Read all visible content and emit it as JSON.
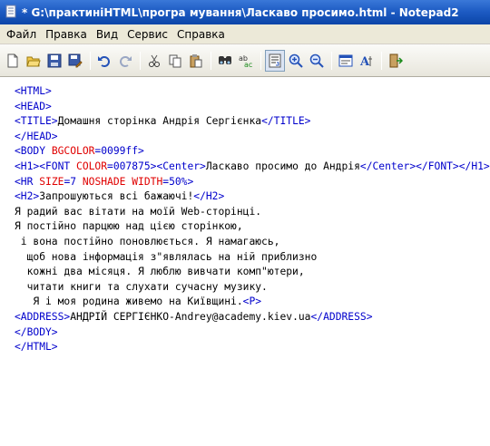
{
  "window": {
    "title": "* G:\\практиніHTML\\програ мування\\Ласкаво просимо.html - Notepad2"
  },
  "menu": [
    "Файл",
    "Правка",
    "Вид",
    "Сервис",
    "Справка"
  ],
  "toolbar": {
    "icons": [
      "new-icon",
      "open-icon",
      "save-icon",
      "save-as-icon",
      "undo-icon",
      "redo-icon",
      "cut-icon",
      "copy-icon",
      "paste-icon",
      "find-icon",
      "replace-icon",
      "word-wrap-icon",
      "zoom-in-icon",
      "zoom-out-icon",
      "scheme-icon",
      "font-icon",
      "exit-icon"
    ]
  },
  "colors": {
    "tag": "#0000cc",
    "attribute": "#e00000",
    "text": "#000000",
    "titlebar": "#1e5cc4"
  },
  "code_lines": [
    [
      [
        "tag",
        "<HTML>"
      ]
    ],
    [
      [
        "tag",
        "<HEAD>"
      ]
    ],
    [
      [
        "tag",
        "<TITLE>"
      ],
      [
        "txt",
        "Домашня сторінка Андрія Сергієнка"
      ],
      [
        "tag",
        "</TITLE>"
      ]
    ],
    [
      [
        "tag",
        "</HEAD>"
      ]
    ],
    [
      [
        "tag",
        "<BODY "
      ],
      [
        "attr",
        "BGCOLOR"
      ],
      [
        "tag",
        "=0099ff>"
      ]
    ],
    [
      [
        "tag",
        "<H1><FONT "
      ],
      [
        "attr",
        "COLOR"
      ],
      [
        "tag",
        "=007875><Center>"
      ],
      [
        "txt",
        "Ласкаво просимо до Андрія"
      ],
      [
        "tag",
        "</Center></FONT></H1>"
      ]
    ],
    [
      [
        "tag",
        "<HR "
      ],
      [
        "attr",
        "SIZE"
      ],
      [
        "tag",
        "=7 "
      ],
      [
        "attr",
        "NOSHADE WIDTH"
      ],
      [
        "tag",
        "=50%>"
      ]
    ],
    [
      [
        "tag",
        "<H2>"
      ],
      [
        "txt",
        "Запрошуються всі бажаючі!"
      ],
      [
        "tag",
        "</H2>"
      ]
    ],
    [
      [
        "txt",
        "Я радий вас вітати на моїй Web-сторінці."
      ]
    ],
    [
      [
        "txt",
        "Я постійно парцюю над цією сторінкою,"
      ]
    ],
    [
      [
        "txt",
        " і вона постійно поновлюється. Я намагаюсь,"
      ]
    ],
    [
      [
        "txt",
        "  щоб нова інформація з\"являлась на ній приблизно"
      ]
    ],
    [
      [
        "txt",
        "  кожні два місяця. Я люблю вивчати комп\"ютери,"
      ]
    ],
    [
      [
        "txt",
        "  читати книги та слухати сучасну музику."
      ]
    ],
    [
      [
        "txt",
        "   Я і моя родина живемо на Київщині."
      ],
      [
        "tag",
        "<P>"
      ]
    ],
    [
      [
        "tag",
        "<ADDRESS>"
      ],
      [
        "txt",
        "АНДРІЙ СЕРГІЄНКО-Andrey@academy.kiev.ua"
      ],
      [
        "tag",
        "</ADDRESS>"
      ]
    ],
    [
      [
        "tag",
        "</BODY>"
      ]
    ],
    [
      [
        "tag",
        "</HTML>"
      ]
    ]
  ]
}
